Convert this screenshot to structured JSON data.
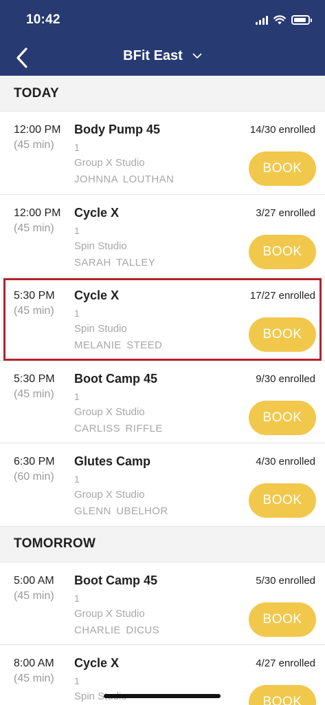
{
  "status_bar": {
    "time": "10:42"
  },
  "header": {
    "title": "BFit East"
  },
  "sections": [
    {
      "label": "TODAY",
      "classes": [
        {
          "time": "12:00 PM",
          "duration": "(45 min)",
          "name": "Body Pump 45",
          "number": "1",
          "room": "Group X Studio",
          "instructor": "JOHNNA LOUTHAN",
          "enrolled": "14/30 enrolled",
          "action": "BOOK"
        },
        {
          "time": "12:00 PM",
          "duration": "(45 min)",
          "name": "Cycle X",
          "number": "1",
          "room": "Spin Studio",
          "instructor": "SARAH TALLEY",
          "enrolled": "3/27 enrolled",
          "action": "BOOK"
        },
        {
          "time": "5:30 PM",
          "duration": "(45 min)",
          "name": "Cycle X",
          "number": "1",
          "room": "Spin Studio",
          "instructor": "MELANIE STEED",
          "enrolled": "17/27 enrolled",
          "action": "BOOK"
        },
        {
          "time": "5:30 PM",
          "duration": "(45 min)",
          "name": "Boot Camp 45",
          "number": "1",
          "room": "Group X Studio",
          "instructor": "CARLISS RIFFLE",
          "enrolled": "9/30 enrolled",
          "action": "BOOK"
        },
        {
          "time": "6:30 PM",
          "duration": "(60 min)",
          "name": "Glutes Camp",
          "number": "1",
          "room": "Group X Studio",
          "instructor": "GLENN UBELHOR",
          "enrolled": "4/30 enrolled",
          "action": "BOOK"
        }
      ]
    },
    {
      "label": "TOMORROW",
      "classes": [
        {
          "time": "5:00 AM",
          "duration": "(45 min)",
          "name": "Boot Camp 45",
          "number": "1",
          "room": "Group X Studio",
          "instructor": "CHARLIE DICUS",
          "enrolled": "5/30 enrolled",
          "action": "BOOK"
        },
        {
          "time": "8:00 AM",
          "duration": "(45 min)",
          "name": "Cycle X",
          "number": "1",
          "room": "Spin Studio",
          "instructor": "",
          "enrolled": "4/27 enrolled",
          "action": "BOOK"
        }
      ]
    }
  ],
  "colors": {
    "header_bg": "#273a72",
    "book_button": "#f1c84c",
    "highlight": "#b3222c"
  },
  "icons": {
    "back": "chevron-left-icon",
    "dropdown": "chevron-down-icon",
    "signal": "cellular-signal-icon",
    "wifi": "wifi-icon",
    "battery": "battery-icon"
  }
}
